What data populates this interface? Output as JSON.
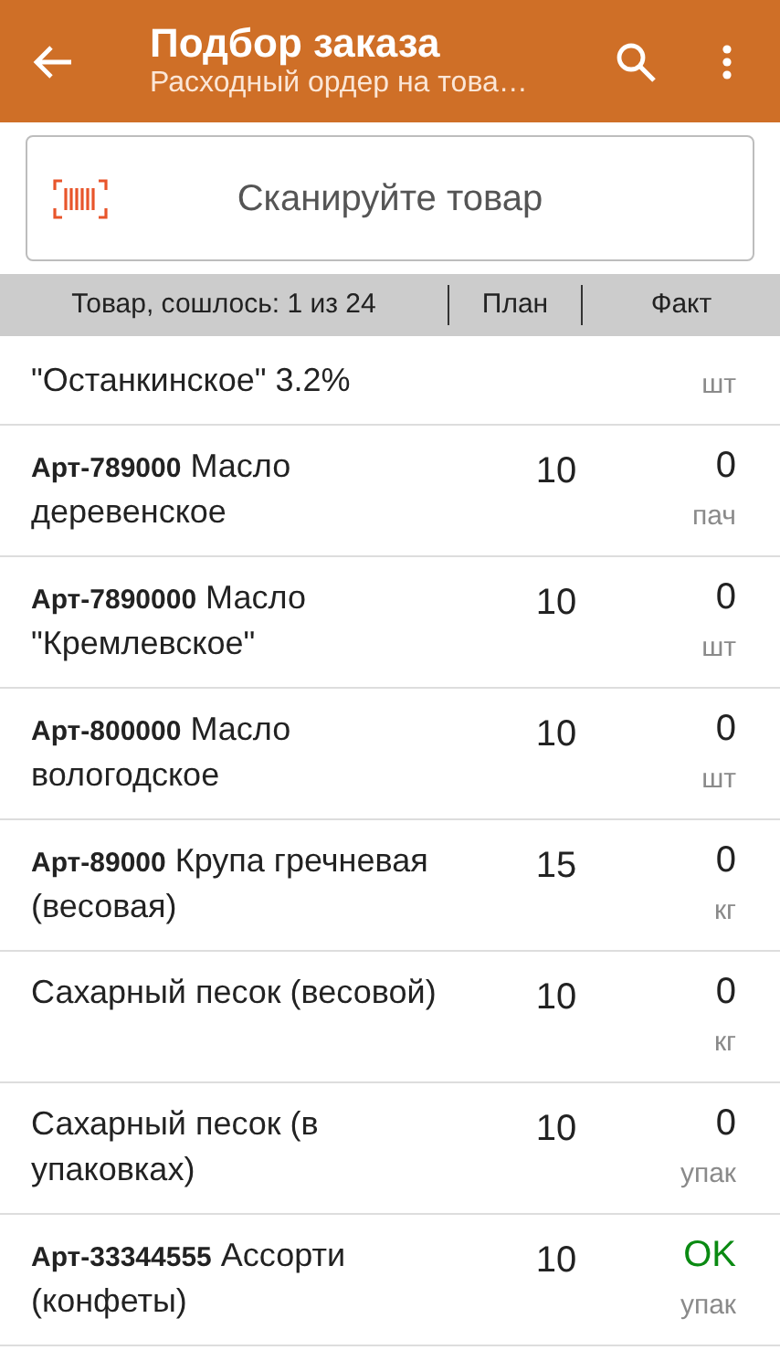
{
  "app_bar": {
    "title": "Подбор заказа",
    "subtitle": "Расходный ордер на това…"
  },
  "scan": {
    "placeholder": "Сканируйте товар"
  },
  "columns": [
    "Товар, сошлось: 1 из 24",
    "План",
    "Факт"
  ],
  "items": [
    {
      "name": "\"Останкинское\" 3.2%",
      "unit": "шт"
    },
    {
      "name": "**Арт-789000** Масло деревенское",
      "plan": "10",
      "fact": "0",
      "unit": "пач",
      "matched": false
    },
    {
      "name": "**Арт-7890000** Масло \"Кремлевское\"",
      "plan": "10",
      "fact": "0",
      "unit": "шт",
      "matched": false
    },
    {
      "name": "**Арт-800000** Масло вологодское",
      "plan": "10",
      "fact": "0",
      "unit": "шт",
      "matched": false
    },
    {
      "name": "**Арт-89000** Крупа гречневая (весовая)",
      "plan": "15",
      "fact": "0",
      "unit": "кг",
      "matched": false
    },
    {
      "name": "Сахарный песок (весовой)",
      "plan": "10",
      "fact": "0",
      "unit": "кг",
      "matched": false
    },
    {
      "name": "Сахарный песок (в упаковках)",
      "plan": "10",
      "fact": "0",
      "unit": "упак",
      "matched": false
    },
    {
      "name": "**Арт-33344555** Ассорти (конфеты)",
      "plan": "10",
      "fact": "OK",
      "unit": "упак",
      "matched": true
    }
  ]
}
